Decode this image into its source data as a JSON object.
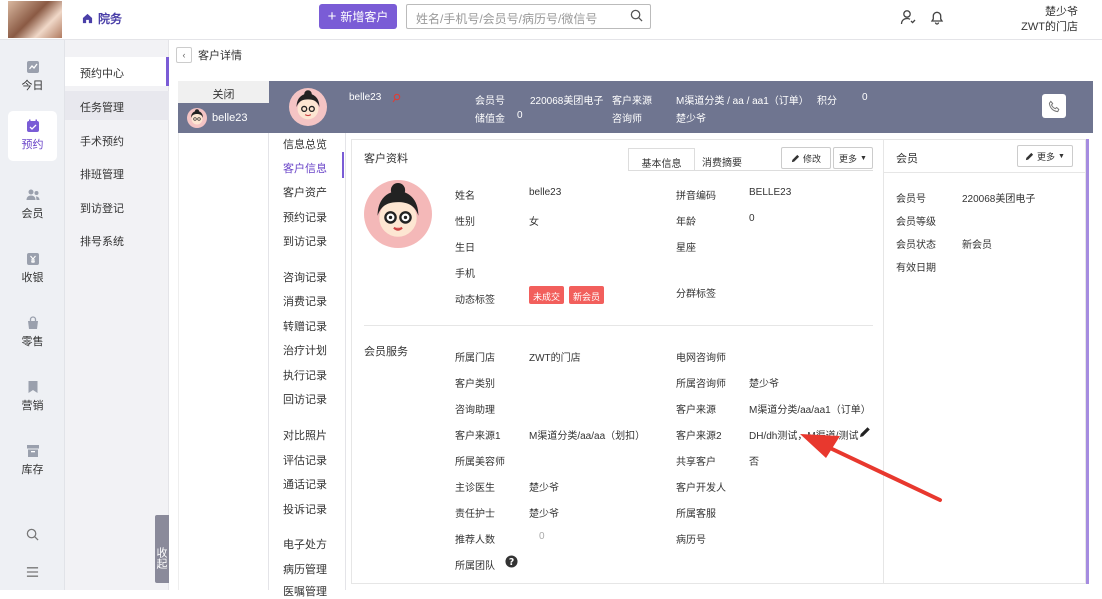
{
  "header": {
    "module": "院务",
    "add_button": "新增客户",
    "search_placeholder": "姓名/手机号/会员号/病历号/微信号",
    "user": "楚少爷",
    "store": "ZWT的门店"
  },
  "rail": [
    {
      "label": "今日",
      "icon": "chart-icon"
    },
    {
      "label": "预约",
      "icon": "calendar-icon",
      "active": true
    },
    {
      "label": "会员",
      "icon": "members-icon"
    },
    {
      "label": "收银",
      "icon": "cashier-icon"
    },
    {
      "label": "零售",
      "icon": "bag-icon"
    },
    {
      "label": "营销",
      "icon": "bookmark-icon"
    },
    {
      "label": "库存",
      "icon": "box-icon"
    }
  ],
  "submenu": [
    "预约中心",
    "任务管理",
    "手术预约",
    "排班管理",
    "到访登记",
    "排号系统"
  ],
  "collapse_label": "收起",
  "breadcrumb": "客户详情",
  "tabs": {
    "close": "关闭",
    "patient": "belle23"
  },
  "band": {
    "name": "belle23",
    "member_no_label": "会员号",
    "member_no": "220068美团电子",
    "source_label": "客户来源",
    "source": "M渠道分类 / aa / aa1（订单）",
    "points_label": "积分",
    "points": "0",
    "balance_label": "储值金",
    "balance": "0",
    "consultant_label": "咨询师",
    "consultant": "楚少爷"
  },
  "nav": [
    "信息总览",
    "客户信息",
    "客户资产",
    "预约记录",
    "到访记录",
    "咨询记录",
    "消费记录",
    "转赠记录",
    "治疗计划",
    "执行记录",
    "回访记录",
    "对比照片",
    "评估记录",
    "通话记录",
    "投诉记录",
    "电子处方",
    "病历管理",
    "医嘱管理"
  ],
  "profile": {
    "section_title": "客户资料",
    "tab_basic": "基本信息",
    "tab_spend": "消费摘要",
    "edit": "修改",
    "more": "更多",
    "fields_left": [
      {
        "label": "姓名",
        "value": "belle23"
      },
      {
        "label": "性别",
        "value": "女"
      },
      {
        "label": "生日",
        "value": ""
      },
      {
        "label": "手机",
        "value": ""
      },
      {
        "label": "动态标签",
        "value": ""
      }
    ],
    "tags": [
      "未成交",
      "新会员"
    ],
    "fields_right": [
      {
        "label": "拼音编码",
        "value": "BELLE23"
      },
      {
        "label": "年龄",
        "value": "0"
      },
      {
        "label": "星座",
        "value": ""
      },
      {
        "label": "分群标签",
        "value": ""
      }
    ]
  },
  "service": {
    "section_title": "会员服务",
    "left": [
      {
        "label": "所属门店",
        "value": "ZWT的门店"
      },
      {
        "label": "客户类别",
        "value": ""
      },
      {
        "label": "咨询助理",
        "value": ""
      },
      {
        "label": "客户来源1",
        "value": "M渠道分类/aa/aa（划扣）"
      },
      {
        "label": "所属美容师",
        "value": ""
      },
      {
        "label": "主诊医生",
        "value": "楚少爷"
      },
      {
        "label": "责任护士",
        "value": "楚少爷"
      },
      {
        "label": "推荐人数",
        "value": "0"
      },
      {
        "label": "所属团队",
        "value": ""
      }
    ],
    "right": [
      {
        "label": "电网咨询师",
        "value": ""
      },
      {
        "label": "所属咨询师",
        "value": "楚少爷"
      },
      {
        "label": "客户来源",
        "value": "M渠道分类/aa/aa1（订单）"
      },
      {
        "label": "客户来源2",
        "value": "DH/dh测试，M渠道/测试"
      },
      {
        "label": "共享客户",
        "value": "否"
      },
      {
        "label": "客户开发人",
        "value": ""
      },
      {
        "label": "所属客服",
        "value": ""
      },
      {
        "label": "病历号",
        "value": ""
      }
    ]
  },
  "member_panel": {
    "title": "会员",
    "more": "更多",
    "fields": [
      {
        "label": "会员号",
        "value": "220068美团电子"
      },
      {
        "label": "会员等级",
        "value": ""
      },
      {
        "label": "会员状态",
        "value": "新会员"
      },
      {
        "label": "有效日期",
        "value": ""
      }
    ]
  },
  "colors": {
    "accent": "#7a5cd6",
    "band": "#6f7590",
    "tag": "#f25f5c",
    "arrow": "#e8382e"
  }
}
